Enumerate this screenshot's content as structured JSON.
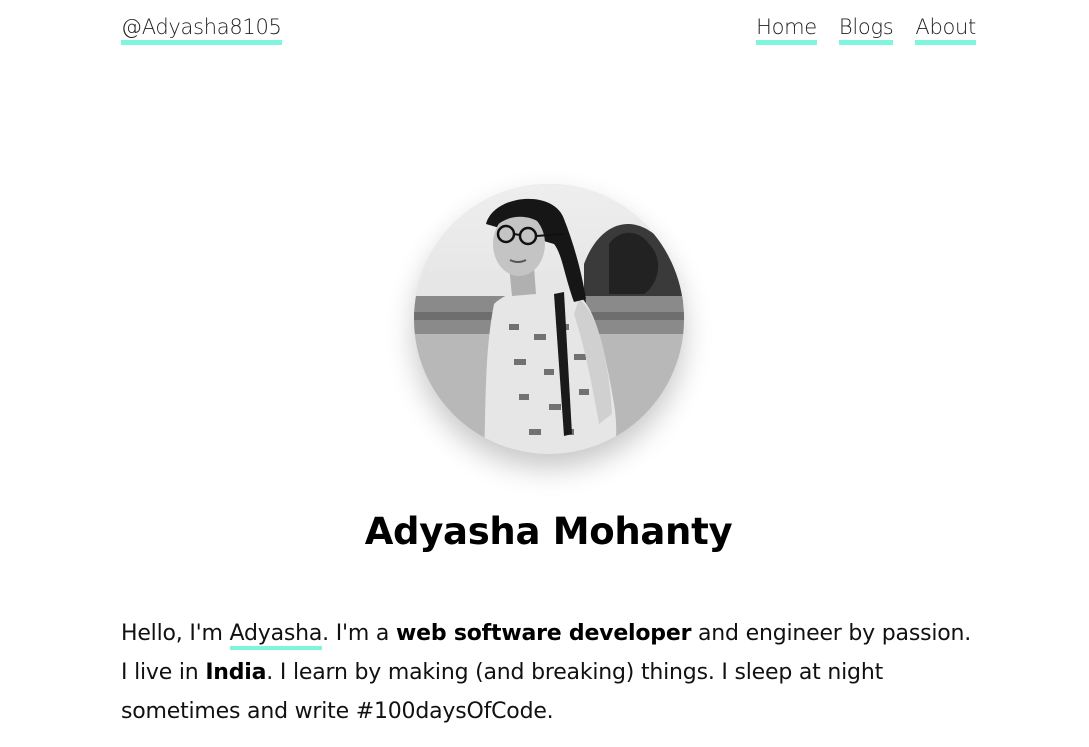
{
  "header": {
    "brand": "@Adyasha8105",
    "nav": [
      {
        "label": "Home"
      },
      {
        "label": "Blogs"
      },
      {
        "label": "About"
      }
    ]
  },
  "profile": {
    "name": "Adyasha Mohanty"
  },
  "bio": {
    "greeting": "Hello, I'm ",
    "name_link": "Adyasha",
    "part2": ". I'm a ",
    "role": "web software developer",
    "part3": " and engineer by passion. I live in ",
    "country": "India",
    "part4": ". I learn by making (and breaking) things. I sleep at night sometimes and write #100daysOfCode."
  },
  "colors": {
    "accent_underline": "#7ef5dc",
    "text": "#111111",
    "background": "#ffffff"
  }
}
